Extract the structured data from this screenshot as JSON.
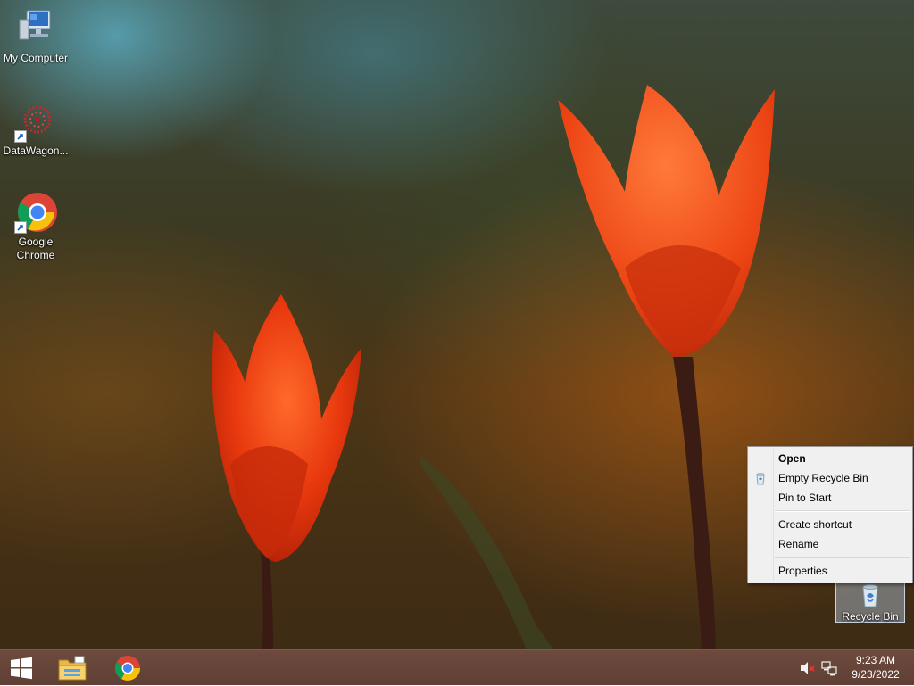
{
  "desktop": {
    "icons": [
      {
        "label": "My Computer",
        "icon": "computer-icon"
      },
      {
        "label": "DataWagon...",
        "icon": "datawagon-icon"
      },
      {
        "label": "Google Chrome",
        "icon": "chrome-icon"
      },
      {
        "label": "Recycle Bin",
        "icon": "recycle-bin-icon"
      }
    ]
  },
  "context_menu": {
    "items": [
      {
        "label": "Open"
      },
      {
        "label": "Empty Recycle Bin",
        "icon": "recycle-bin-icon"
      },
      {
        "label": "Pin to Start"
      },
      {
        "label": "Create shortcut"
      },
      {
        "label": "Rename"
      },
      {
        "label": "Properties"
      }
    ]
  },
  "taskbar": {
    "start_icon": "windows-logo-icon",
    "pinned": [
      {
        "icon": "file-explorer-icon"
      },
      {
        "icon": "chrome-icon"
      }
    ],
    "tray": {
      "volume_icon": "volume-muted-icon",
      "network_icon": "network-icon"
    },
    "clock": {
      "time": "9:23 AM",
      "date": "9/23/2022"
    }
  },
  "colors": {
    "taskbar": "#6e4a3e",
    "menu_bg": "#f0f0f0",
    "tulip": "#e83a12"
  }
}
